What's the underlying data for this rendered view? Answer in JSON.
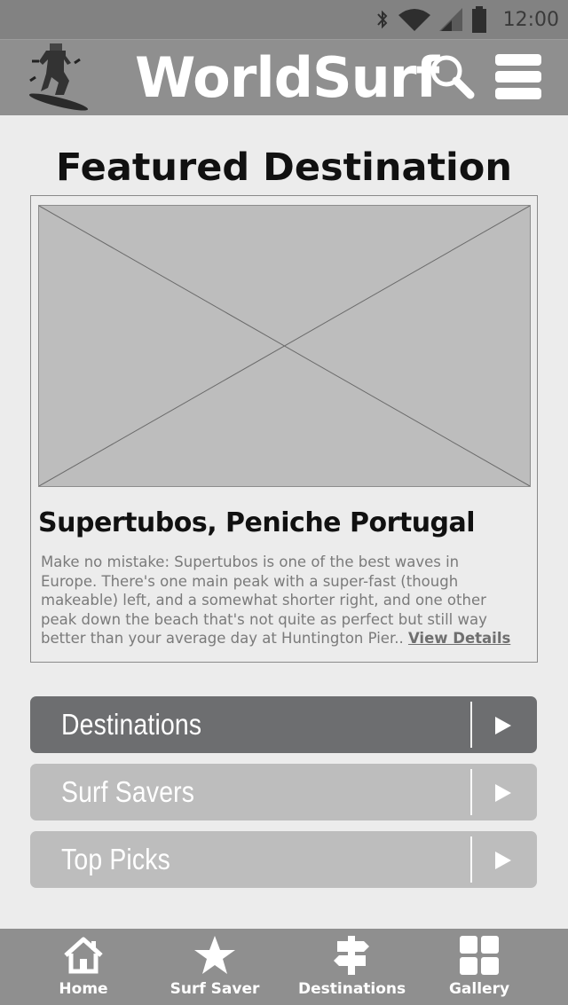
{
  "status_bar": {
    "time": "12:00",
    "icons": [
      "bluetooth-icon",
      "wifi-icon",
      "signal-icon",
      "battery-icon"
    ]
  },
  "app_bar": {
    "title": "WorldSurf",
    "logo": "surfer-logo",
    "search_icon": "search-icon",
    "menu_icon": "menu-icon"
  },
  "featured": {
    "heading": "Featured Destination",
    "title": "Supertubos, Peniche Portugal",
    "description_lines": [
      "Make no mistake: Supertubos is one of the best waves in",
      "Europe. There's one main peak with a super-fast (though",
      "makeable) left, and a somewhat shorter right, and one other",
      "peak down the beach that's not quite as perfect but still way",
      "better than your average day at Huntington Pier.."
    ],
    "link_label": "View Details"
  },
  "nav_list": [
    {
      "label": "Destinations",
      "active": true
    },
    {
      "label": "Surf Savers",
      "active": false
    },
    {
      "label": "Top Picks",
      "active": false
    }
  ],
  "tab_bar": [
    {
      "label": "Home",
      "icon": "home-icon"
    },
    {
      "label": "Surf Saver",
      "icon": "star-icon"
    },
    {
      "label": "Destinations",
      "icon": "signpost-icon"
    },
    {
      "label": "Gallery",
      "icon": "grid-icon"
    }
  ],
  "colors": {
    "bar": "#8f8f8f",
    "active_button": "#6d6e70",
    "inactive_button": "#bdbdbd",
    "background": "#ececec"
  }
}
